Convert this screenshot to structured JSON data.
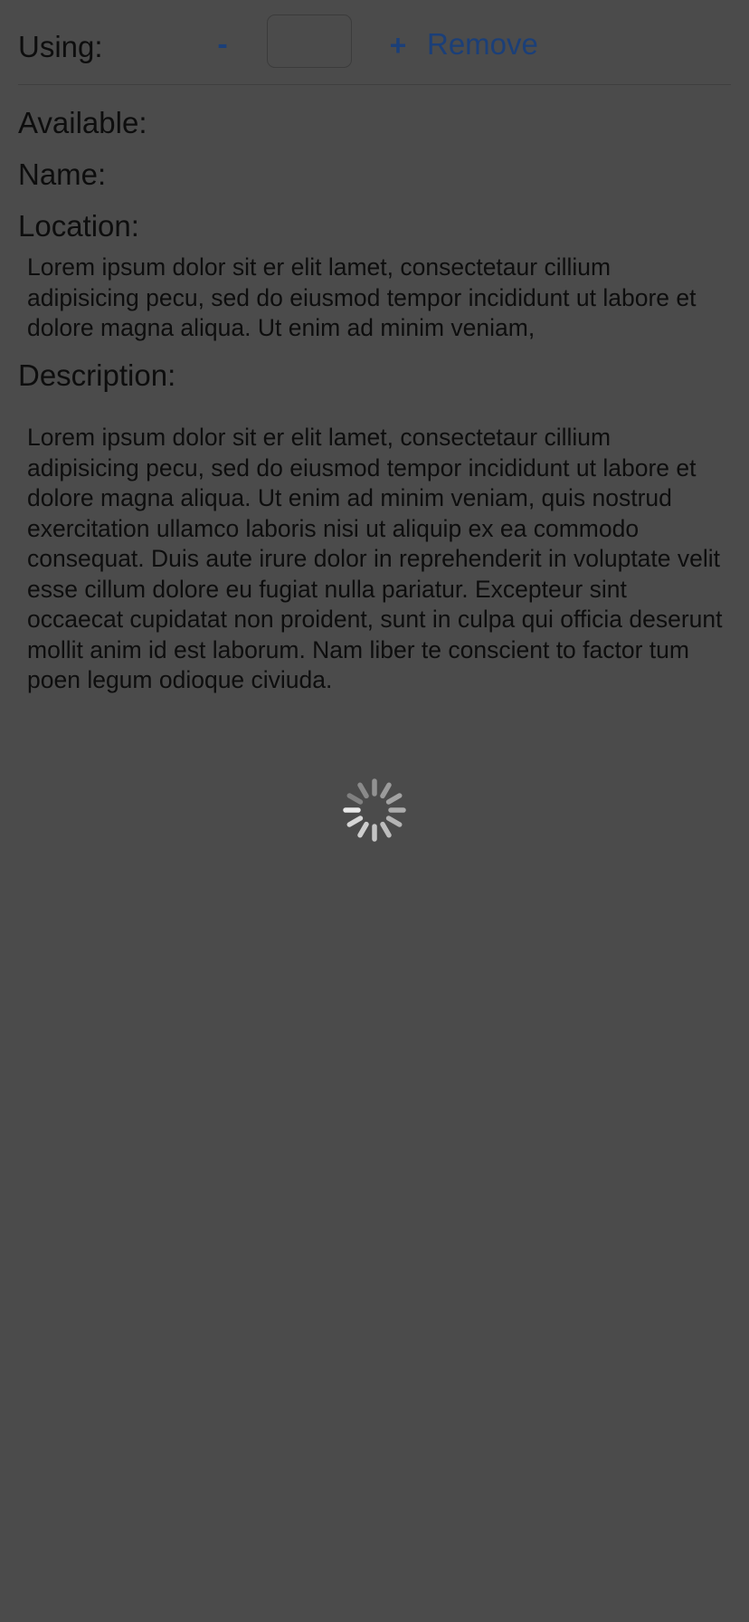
{
  "using": {
    "label": "Using:",
    "minus_label": "-",
    "quantity_value": "",
    "plus_label": "+",
    "remove_label": "Remove"
  },
  "details": {
    "available_label": "Available:",
    "name_label": "Name:",
    "location_label": "Location:",
    "location_text": "Lorem ipsum dolor sit er elit lamet, consectetaur cillium adipisicing pecu, sed do eiusmod tempor incididunt ut labore et dolore magna aliqua. Ut enim ad minim veniam,",
    "description_label": "Description:",
    "description_text": "Lorem ipsum dolor sit er elit lamet, consectetaur cillium adipisicing pecu, sed do eiusmod tempor incididunt ut labore et dolore magna aliqua. Ut enim ad minim veniam, quis nostrud exercitation ullamco laboris nisi ut aliquip ex ea commodo consequat. Duis aute irure dolor in reprehenderit in voluptate velit esse cillum dolore eu fugiat nulla pariatur. Excepteur sint occaecat cupidatat non proident, sunt in culpa qui officia deserunt mollit anim id est laborum. Nam liber te conscient to factor tum poen legum odioque civiuda."
  },
  "loading": {
    "icon": "activity-spinner-icon"
  },
  "colors": {
    "background": "#4b4b4b",
    "accent": "#1b3f78",
    "text": "#0d0d0d"
  }
}
